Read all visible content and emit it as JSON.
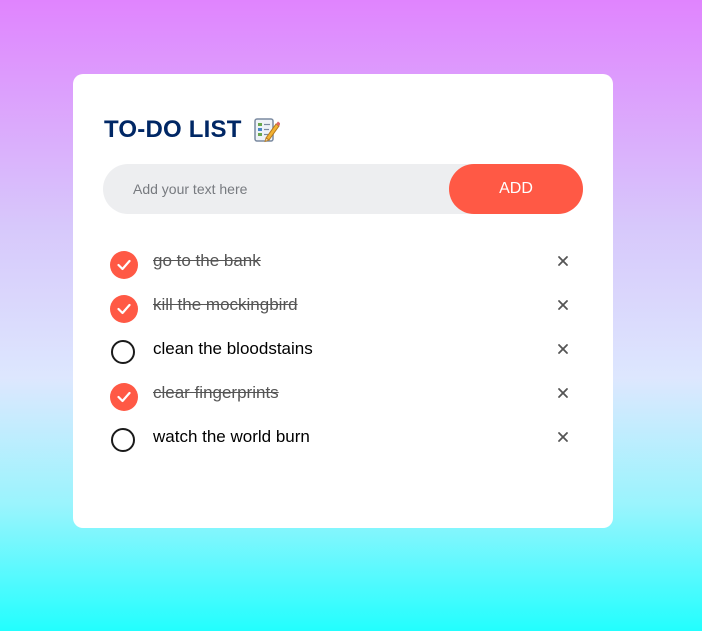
{
  "app": {
    "title": "TO-DO LIST",
    "title_icon": "memo-pencil-icon"
  },
  "input": {
    "placeholder": "Add your text here",
    "value": ""
  },
  "add_button": {
    "label": "ADD"
  },
  "tasks": [
    {
      "text": "go to the bank",
      "done": true
    },
    {
      "text": "kill the mockingbird",
      "done": true
    },
    {
      "text": "clean the bloodstains",
      "done": false
    },
    {
      "text": "clear fingerprints",
      "done": true
    },
    {
      "text": "watch the world burn",
      "done": false
    }
  ],
  "icons": {
    "checked": "check-circle-icon",
    "unchecked": "empty-circle-icon",
    "delete": "close-icon"
  },
  "colors": {
    "accent": "#ff5945",
    "title": "#002765",
    "input_bg": "#edeef0",
    "gradient_top": "#e084fe",
    "gradient_bottom": "#22fefe"
  }
}
